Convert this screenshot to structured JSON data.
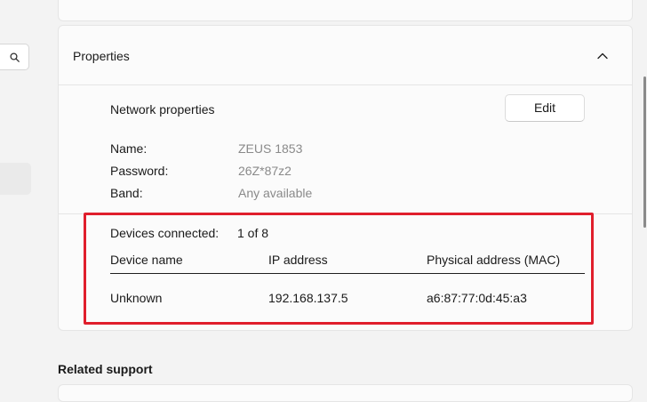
{
  "properties": {
    "header_title": "Properties",
    "section_title": "Network properties",
    "edit_label": "Edit",
    "fields": [
      {
        "label": "Name:",
        "value": "ZEUS 1853"
      },
      {
        "label": "Password:",
        "value": "26Z*87z2"
      },
      {
        "label": "Band:",
        "value": "Any available"
      }
    ]
  },
  "devices": {
    "label": "Devices connected:",
    "count": "1 of 8",
    "columns": [
      "Device name",
      "IP address",
      "Physical address (MAC)"
    ],
    "rows": [
      [
        "Unknown",
        "192.168.137.5",
        "a6:87:77:0d:45:a3"
      ]
    ]
  },
  "related_support": {
    "title": "Related support"
  },
  "icons": {
    "search": "search-icon",
    "collapse": "chevron-up-icon"
  },
  "colors": {
    "highlight": "#e01e2c"
  }
}
